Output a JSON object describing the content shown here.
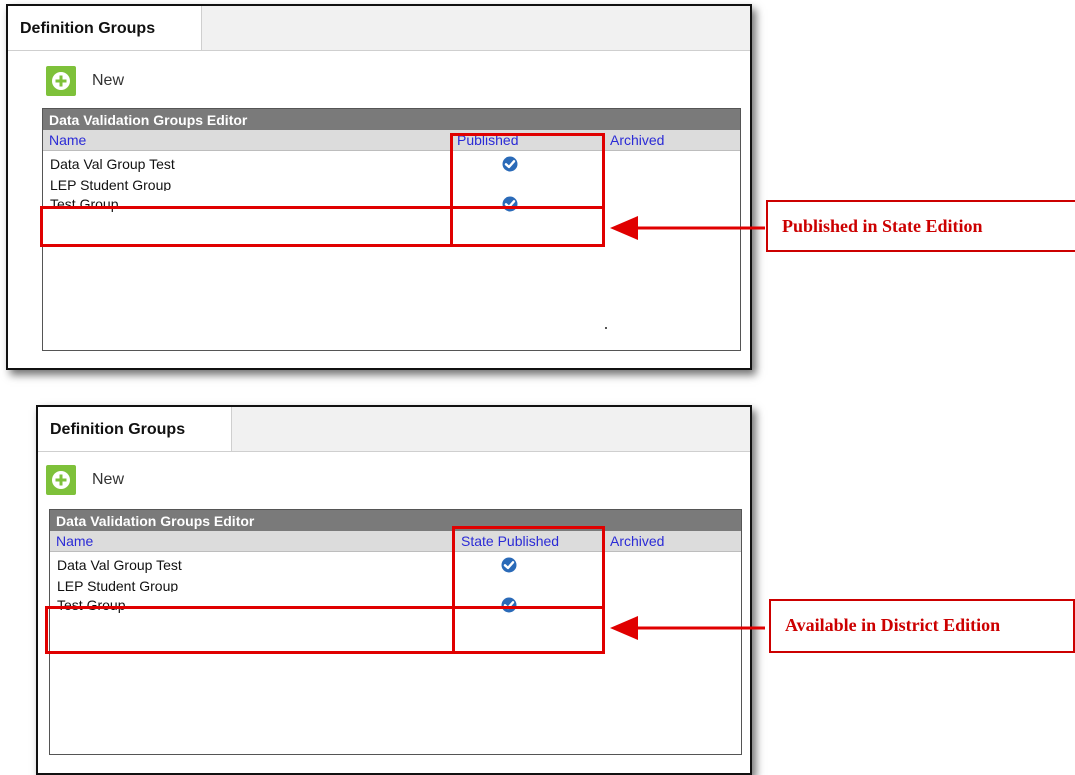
{
  "panels": [
    {
      "tab_label": "Definition Groups",
      "new_label": "New",
      "editor_title": "Data Validation Groups Editor",
      "columns": {
        "name": "Name",
        "published": "Published",
        "archived": "Archived"
      },
      "rows": [
        {
          "name": "Data Val Group Test",
          "published": true
        },
        {
          "name": "LEP Student Group",
          "published": false
        },
        {
          "name": "Test Group",
          "published": true
        }
      ],
      "callout": "Published in State Edition"
    },
    {
      "tab_label": "Definition Groups",
      "new_label": "New",
      "editor_title": "Data Validation Groups Editor",
      "columns": {
        "name": "Name",
        "published": "State Published",
        "archived": "Archived"
      },
      "rows": [
        {
          "name": "Data Val Group Test",
          "published": true
        },
        {
          "name": "LEP Student Group",
          "published": false
        },
        {
          "name": "Test Group",
          "published": true
        }
      ],
      "callout": "Available in District Edition"
    }
  ],
  "colors": {
    "highlight": "#e00000",
    "check": "#2a6ab8",
    "new_button": "#7ec13a",
    "header_text": "#2b2bd6"
  },
  "icons": {
    "new": "plus-circle-icon",
    "published": "check-circle-icon"
  }
}
